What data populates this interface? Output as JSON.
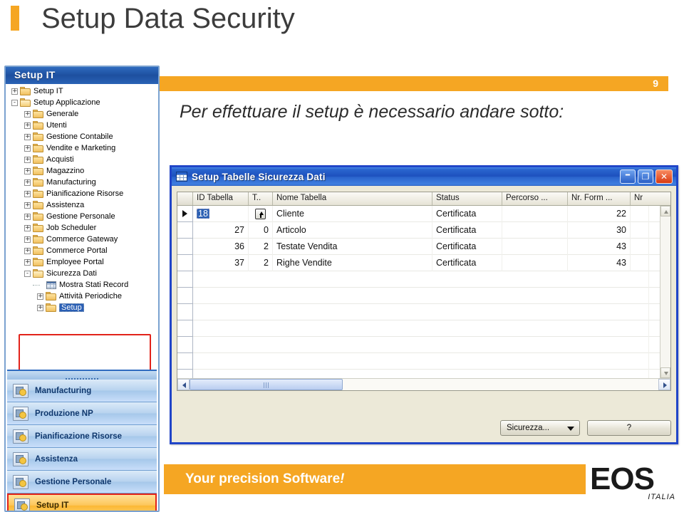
{
  "slide": {
    "title": "Setup Data Security",
    "page_number": "9",
    "caption": "Per effettuare il setup è necessario andare sotto:",
    "accent_color": "#f5a623"
  },
  "footer": {
    "tagline": "Your precision Software",
    "tagline_bang": "!",
    "logo_word": "EOS",
    "logo_sub": "ITALIA"
  },
  "sidebar": {
    "header": "Setup IT",
    "tree": [
      {
        "label": "Setup IT",
        "level": 0,
        "expander": "+",
        "icon": "folder-icon",
        "selected": false
      },
      {
        "label": "Setup Applicazione",
        "level": 0,
        "expander": "-",
        "icon": "folder-open-icon",
        "selected": false
      },
      {
        "label": "Generale",
        "level": 1,
        "expander": "+",
        "icon": "folder-icon",
        "selected": false
      },
      {
        "label": "Utenti",
        "level": 1,
        "expander": "+",
        "icon": "folder-icon",
        "selected": false
      },
      {
        "label": "Gestione Contabile",
        "level": 1,
        "expander": "+",
        "icon": "folder-icon",
        "selected": false
      },
      {
        "label": "Vendite e Marketing",
        "level": 1,
        "expander": "+",
        "icon": "folder-icon",
        "selected": false
      },
      {
        "label": "Acquisti",
        "level": 1,
        "expander": "+",
        "icon": "folder-icon",
        "selected": false
      },
      {
        "label": "Magazzino",
        "level": 1,
        "expander": "+",
        "icon": "folder-icon",
        "selected": false
      },
      {
        "label": "Manufacturing",
        "level": 1,
        "expander": "+",
        "icon": "folder-icon",
        "selected": false
      },
      {
        "label": "Pianificazione Risorse",
        "level": 1,
        "expander": "+",
        "icon": "folder-icon",
        "selected": false
      },
      {
        "label": "Assistenza",
        "level": 1,
        "expander": "+",
        "icon": "folder-icon",
        "selected": false
      },
      {
        "label": "Gestione Personale",
        "level": 1,
        "expander": "+",
        "icon": "folder-icon",
        "selected": false
      },
      {
        "label": "Job Scheduler",
        "level": 1,
        "expander": "+",
        "icon": "folder-icon",
        "selected": false
      },
      {
        "label": "Commerce Gateway",
        "level": 1,
        "expander": "+",
        "icon": "folder-icon",
        "selected": false
      },
      {
        "label": "Commerce Portal",
        "level": 1,
        "expander": "+",
        "icon": "folder-icon",
        "selected": false
      },
      {
        "label": "Employee Portal",
        "level": 1,
        "expander": "+",
        "icon": "folder-icon",
        "selected": false
      },
      {
        "label": "Sicurezza Dati",
        "level": 1,
        "expander": "-",
        "icon": "folder-open-icon",
        "selected": false
      },
      {
        "label": "Mostra Stati Record",
        "level": 2,
        "expander": "",
        "icon": "grid-icon",
        "selected": false
      },
      {
        "label": "Attività Periodiche",
        "level": 2,
        "expander": "+",
        "icon": "folder-icon",
        "selected": false
      },
      {
        "label": "Setup",
        "level": 2,
        "expander": "+",
        "icon": "folder-icon",
        "selected": true
      }
    ],
    "nav_buttons": [
      {
        "label": "Manufacturing",
        "active": false
      },
      {
        "label": "Produzione NP",
        "active": false
      },
      {
        "label": "Pianificazione Risorse",
        "active": false
      },
      {
        "label": "Assistenza",
        "active": false
      },
      {
        "label": "Gestione Personale",
        "active": false
      },
      {
        "label": "Setup IT",
        "active": true
      }
    ],
    "highlight_color": "#e2231a"
  },
  "dialog": {
    "title": "Setup Tabelle Sicurezza Dati",
    "window_buttons": {
      "minimize": "–",
      "maximize": "❐",
      "close": "✕"
    },
    "grid": {
      "columns": [
        {
          "key": "id",
          "label": "ID Tabella"
        },
        {
          "key": "t",
          "label": "T.."
        },
        {
          "key": "nome",
          "label": "Nome Tabella"
        },
        {
          "key": "status",
          "label": "Status"
        },
        {
          "key": "perc",
          "label": "Percorso ..."
        },
        {
          "key": "form",
          "label": "Nr. Form ..."
        },
        {
          "key": "nr",
          "label": "Nr"
        }
      ],
      "rows": [
        {
          "id": "18",
          "t": "",
          "nome": "Cliente",
          "status": "Certificata",
          "perc": "",
          "form": "22",
          "nr": "",
          "current": true,
          "id_selected": true,
          "has_lookup": true
        },
        {
          "id": "27",
          "t": "0",
          "nome": "Articolo",
          "status": "Certificata",
          "perc": "",
          "form": "30",
          "nr": "",
          "current": false,
          "id_selected": false,
          "has_lookup": false
        },
        {
          "id": "36",
          "t": "2",
          "nome": "Testate Vendita",
          "status": "Certificata",
          "perc": "",
          "form": "43",
          "nr": "",
          "current": false,
          "id_selected": false,
          "has_lookup": false
        },
        {
          "id": "37",
          "t": "2",
          "nome": "Righe Vendite",
          "status": "Certificata",
          "perc": "",
          "form": "43",
          "nr": "",
          "current": false,
          "id_selected": false,
          "has_lookup": false
        }
      ],
      "empty_row_count": 7
    },
    "buttons": {
      "security": "Sicurezza...",
      "help": "?"
    }
  }
}
